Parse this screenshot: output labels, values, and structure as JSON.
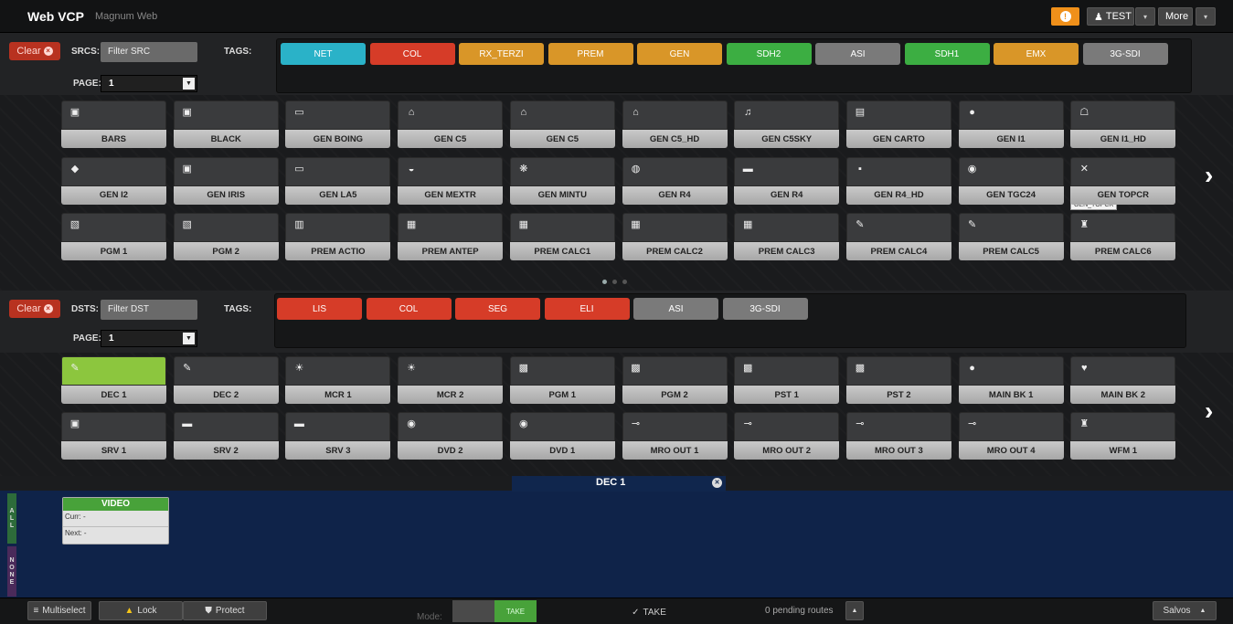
{
  "header": {
    "brand": "Web VCP",
    "subtitle": "Magnum Web",
    "user_label": "TEST",
    "more_label": "More",
    "warn_glyph": "!",
    "caret_glyph": "▾"
  },
  "sources": {
    "clear_label": "Clear",
    "label": "SRCS:",
    "filter_placeholder": "Filter SRC",
    "tags_label": "TAGS:",
    "page_label": "PAGE:",
    "page_value": "1",
    "tags": [
      {
        "label": "NET",
        "color": "#2ab2c8"
      },
      {
        "label": "COL",
        "color": "#d63c28"
      },
      {
        "label": "RX_TERZI",
        "color": "#d99628"
      },
      {
        "label": "PREM",
        "color": "#d99628"
      },
      {
        "label": "GEN",
        "color": "#d99628"
      },
      {
        "label": "SDH2",
        "color": "#3cae42"
      },
      {
        "label": "ASI",
        "color": "#7a7a7a"
      },
      {
        "label": "SDH1",
        "color": "#3cae42"
      },
      {
        "label": "EMX",
        "color": "#d99628"
      },
      {
        "label": "3G-SDI",
        "color": "#7a7a7a"
      }
    ],
    "buttons": [
      {
        "label": "BARS",
        "icon": "▣"
      },
      {
        "label": "BLACK",
        "icon": "▣"
      },
      {
        "label": "GEN BOING",
        "icon": "▭"
      },
      {
        "label": "GEN C5",
        "icon": "⌂"
      },
      {
        "label": "GEN C5",
        "icon": "⌂"
      },
      {
        "label": "GEN C5_HD",
        "icon": "⌂"
      },
      {
        "label": "GEN C5SKY",
        "icon": "♫"
      },
      {
        "label": "GEN CARTO",
        "icon": "▤"
      },
      {
        "label": "GEN I1",
        "icon": "●"
      },
      {
        "label": "GEN I1_HD",
        "icon": "☖"
      },
      {
        "label": "GEN I2",
        "icon": "◆"
      },
      {
        "label": "GEN IRIS",
        "icon": "▣"
      },
      {
        "label": "GEN LA5",
        "icon": "▭"
      },
      {
        "label": "GEN MEXTR",
        "icon": "◒"
      },
      {
        "label": "GEN MINTU",
        "icon": "❋"
      },
      {
        "label": "GEN R4",
        "icon": "◍"
      },
      {
        "label": "GEN R4",
        "icon": "▬"
      },
      {
        "label": "GEN R4_HD",
        "icon": "▪"
      },
      {
        "label": "GEN TGC24",
        "icon": "◉"
      },
      {
        "label": "GEN TOPCR",
        "icon": "✕"
      },
      {
        "label": "PGM 1",
        "icon": "▧"
      },
      {
        "label": "PGM 2",
        "icon": "▧"
      },
      {
        "label": "PREM ACTIO",
        "icon": "▥"
      },
      {
        "label": "PREM ANTEP",
        "icon": "▦"
      },
      {
        "label": "PREM CALC1",
        "icon": "▦"
      },
      {
        "label": "PREM CALC2",
        "icon": "▦"
      },
      {
        "label": "PREM CALC3",
        "icon": "▦"
      },
      {
        "label": "PREM CALC4",
        "icon": "✎"
      },
      {
        "label": "PREM CALC5",
        "icon": "✎"
      },
      {
        "label": "PREM CALC6",
        "icon": "♜"
      }
    ],
    "tooltip": "GEN_TOPCR"
  },
  "destinations": {
    "clear_label": "Clear",
    "label": "DSTS:",
    "filter_placeholder": "Filter DST",
    "tags_label": "TAGS:",
    "page_label": "PAGE:",
    "page_value": "1",
    "tags": [
      {
        "label": "LIS",
        "color": "#d63c28"
      },
      {
        "label": "COL",
        "color": "#d63c28"
      },
      {
        "label": "SEG",
        "color": "#d63c28"
      },
      {
        "label": "ELI",
        "color": "#d63c28"
      },
      {
        "label": "ASI",
        "color": "#7a7a7a"
      },
      {
        "label": "3G-SDI",
        "color": "#7a7a7a"
      }
    ],
    "buttons": [
      {
        "label": "DEC 1",
        "icon": "✎",
        "selected": true
      },
      {
        "label": "DEC 2",
        "icon": "✎"
      },
      {
        "label": "MCR 1",
        "icon": "☀"
      },
      {
        "label": "MCR 2",
        "icon": "☀"
      },
      {
        "label": "PGM 1",
        "icon": "▩"
      },
      {
        "label": "PGM 2",
        "icon": "▩"
      },
      {
        "label": "PST 1",
        "icon": "▩"
      },
      {
        "label": "PST 2",
        "icon": "▩"
      },
      {
        "label": "MAIN BK 1",
        "icon": "●"
      },
      {
        "label": "MAIN BK 2",
        "icon": "♥"
      },
      {
        "label": "SRV 1",
        "icon": "▣"
      },
      {
        "label": "SRV 2",
        "icon": "▬"
      },
      {
        "label": "SRV 3",
        "icon": "▬"
      },
      {
        "label": "DVD 2",
        "icon": "◉"
      },
      {
        "label": "DVD 1",
        "icon": "◉"
      },
      {
        "label": "MRO OUT 1",
        "icon": "⊸"
      },
      {
        "label": "MRO OUT 2",
        "icon": "⊸"
      },
      {
        "label": "MRO OUT 3",
        "icon": "⊸"
      },
      {
        "label": "MRO OUT 4",
        "icon": "⊸"
      },
      {
        "label": "WFM 1",
        "icon": "♜"
      }
    ]
  },
  "detail": {
    "tab_title": "DEC 1",
    "close_glyph": "✕",
    "side_all": "ALL",
    "side_none": "NONE",
    "card_title": "VIDEO",
    "curr": "Curr: -",
    "next": "Next: -"
  },
  "footer": {
    "multiselect": "Multiselect",
    "lock": "Lock",
    "protect": "Protect",
    "mode_label": "Mode:",
    "take_small": "TAKE",
    "take": "TAKE",
    "pending": "0 pending routes",
    "salvos": "Salvos"
  },
  "colors": {
    "accent_green": "#8cc63e",
    "warn": "#f0901a",
    "clear_red": "#b83220",
    "detail_bg": "#0f2349"
  }
}
